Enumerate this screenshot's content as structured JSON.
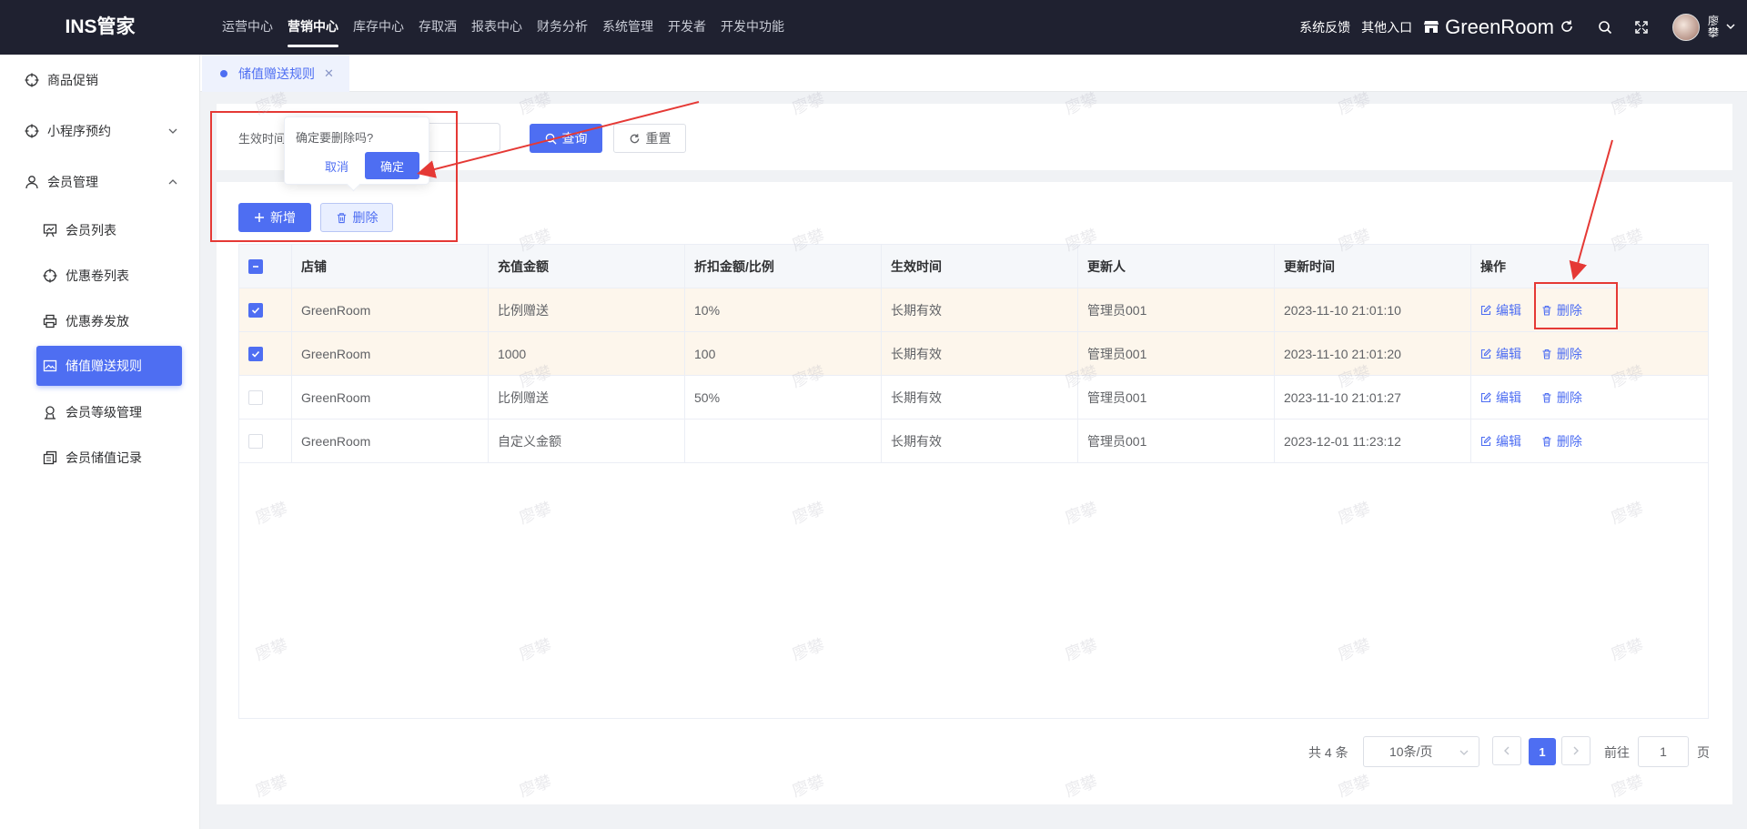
{
  "app": {
    "logo": "INS管家"
  },
  "topnav": {
    "items": [
      "运营中心",
      "营销中心",
      "库存中心",
      "存取酒",
      "报表中心",
      "财务分析",
      "系统管理",
      "开发者",
      "开发中功能"
    ],
    "active_index": 1
  },
  "topright": {
    "feedback": "系统反馈",
    "other_entry": "其他入口",
    "store_name": "GreenRoom",
    "user_name": "廖攀",
    "icons": [
      "store-icon",
      "refresh-icon",
      "search-icon",
      "fullscreen-icon",
      "chevron-down-icon"
    ]
  },
  "sidebar": {
    "items": [
      {
        "label": "商品促销",
        "icon": "target-icon"
      },
      {
        "label": "小程序预约",
        "icon": "target-icon",
        "expanded": false
      },
      {
        "label": "会员管理",
        "icon": "user-icon",
        "expanded": true
      }
    ],
    "sub_items": [
      {
        "label": "会员列表",
        "icon": "chart-board-icon"
      },
      {
        "label": "优惠卷列表",
        "icon": "target-icon"
      },
      {
        "label": "优惠券发放",
        "icon": "print-icon"
      },
      {
        "label": "储值赠送规则",
        "icon": "image-icon",
        "active": true
      },
      {
        "label": "会员等级管理",
        "icon": "badge-icon"
      },
      {
        "label": "会员储值记录",
        "icon": "copy-icon"
      }
    ]
  },
  "tabs": [
    {
      "label": "储值赠送规则",
      "active": true
    }
  ],
  "search": {
    "field_label": "生效时间",
    "query_button": "查询",
    "reset_button": "重置"
  },
  "toolbar": {
    "add_button": "新增",
    "delete_button": "删除"
  },
  "popconfirm": {
    "message": "确定要删除吗?",
    "cancel": "取消",
    "confirm": "确定"
  },
  "table": {
    "columns": [
      "店铺",
      "充值金额",
      "折扣金额/比例",
      "生效时间",
      "更新人",
      "更新时间",
      "操作"
    ],
    "header_checkbox": "indeterminate",
    "rows": [
      {
        "selected": true,
        "shop": "GreenRoom",
        "amount": "比例赠送",
        "discount": "10%",
        "effective": "长期有效",
        "updater": "管理员001",
        "updated_at": "2023-11-10 21:01:10"
      },
      {
        "selected": true,
        "shop": "GreenRoom",
        "amount": "1000",
        "discount": "100",
        "effective": "长期有效",
        "updater": "管理员001",
        "updated_at": "2023-11-10 21:01:20"
      },
      {
        "selected": false,
        "shop": "GreenRoom",
        "amount": "比例赠送",
        "discount": "50%",
        "effective": "长期有效",
        "updater": "管理员001",
        "updated_at": "2023-11-10 21:01:27"
      },
      {
        "selected": false,
        "shop": "GreenRoom",
        "amount": "自定义金额",
        "discount": "",
        "effective": "长期有效",
        "updater": "管理员001",
        "updated_at": "2023-12-01 11:23:12"
      }
    ],
    "edit_label": "编辑",
    "delete_label": "删除"
  },
  "pagination": {
    "total": "共 4 条",
    "page_size": "10条/页",
    "current_page": "1",
    "goto_label": "前往",
    "goto_value": "1",
    "page_suffix": "页"
  },
  "watermark": "廖攀",
  "colors": {
    "primary": "#4e6ef2",
    "topbar": "#1f2130",
    "selected_row": "#fdf6ec",
    "annotation": "#e53935"
  }
}
